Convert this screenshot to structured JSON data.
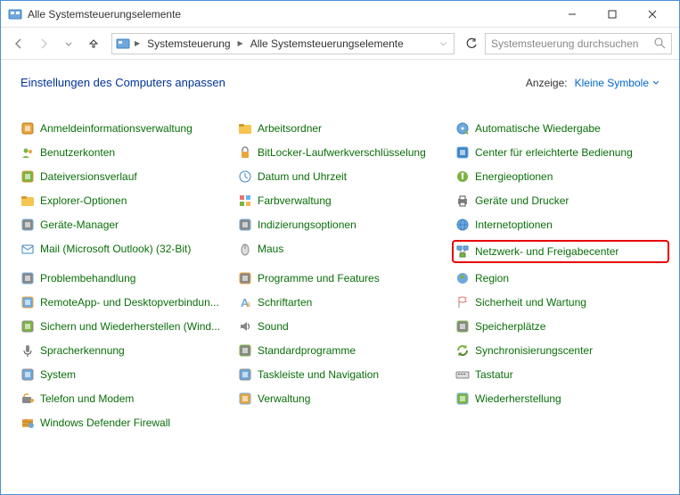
{
  "window": {
    "title": "Alle Systemsteuerungselemente"
  },
  "breadcrumb": {
    "root": "Systemsteuerung",
    "current": "Alle Systemsteuerungselemente"
  },
  "search": {
    "placeholder": "Systemsteuerung durchsuchen"
  },
  "header": {
    "title": "Einstellungen des Computers anpassen",
    "view_label": "Anzeige:",
    "view_value": "Kleine Symbole"
  },
  "highlight": "Netzwerk- und Freigabecenter",
  "items": [
    {
      "label": "Anmeldeinformationsverwaltung",
      "icon": "safe",
      "c1": "#e8a63e",
      "c2": "#b8791a"
    },
    {
      "label": "Arbeitsordner",
      "icon": "folder",
      "c1": "#f5c451",
      "c2": "#d19a2b"
    },
    {
      "label": "Automatische Wiedergabe",
      "icon": "disc",
      "c1": "#6fa8dc",
      "c2": "#3d85c6"
    },
    {
      "label": "Benutzerkonten",
      "icon": "users",
      "c1": "#7cb342",
      "c2": "#e8a63e"
    },
    {
      "label": "BitLocker-Laufwerkverschlüsselung",
      "icon": "lock",
      "c1": "#888",
      "c2": "#e8a63e"
    },
    {
      "label": "Center für erleichterte Bedienung",
      "icon": "access",
      "c1": "#3d85c6",
      "c2": "#6fa8dc"
    },
    {
      "label": "Dateiversionsverlauf",
      "icon": "history",
      "c1": "#7cb342",
      "c2": "#d19a2b"
    },
    {
      "label": "Datum und Uhrzeit",
      "icon": "clock",
      "c1": "#6fa8dc",
      "c2": "#3d85c6"
    },
    {
      "label": "Energieoptionen",
      "icon": "power",
      "c1": "#7cb342",
      "c2": "#558b2f"
    },
    {
      "label": "Explorer-Optionen",
      "icon": "folder",
      "c1": "#f5c451",
      "c2": "#d19a2b"
    },
    {
      "label": "Farbverwaltung",
      "icon": "color",
      "c1": "#e57373",
      "c2": "#64b5f6"
    },
    {
      "label": "Geräte und Drucker",
      "icon": "printer",
      "c1": "#888",
      "c2": "#555"
    },
    {
      "label": "Geräte-Manager",
      "icon": "device",
      "c1": "#888",
      "c2": "#6fa8dc"
    },
    {
      "label": "Indizierungsoptionen",
      "icon": "index",
      "c1": "#888",
      "c2": "#6fa8dc"
    },
    {
      "label": "Internetoptionen",
      "icon": "globe",
      "c1": "#6fa8dc",
      "c2": "#3d85c6"
    },
    {
      "label": "Mail (Microsoft Outlook) (32-Bit)",
      "icon": "mail",
      "c1": "#6fa8dc",
      "c2": "#3d85c6"
    },
    {
      "label": "Maus",
      "icon": "mouse",
      "c1": "#888",
      "c2": "#555"
    },
    {
      "label": "Netzwerk- und Freigabecenter",
      "icon": "network",
      "c1": "#6fa8dc",
      "c2": "#7cb342"
    },
    {
      "label": "Problembehandlung",
      "icon": "trouble",
      "c1": "#888",
      "c2": "#6fa8dc"
    },
    {
      "label": "Programme und Features",
      "icon": "programs",
      "c1": "#888",
      "c2": "#e8a63e"
    },
    {
      "label": "Region",
      "icon": "region",
      "c1": "#6fa8dc",
      "c2": "#7cb342"
    },
    {
      "label": "RemoteApp- und Desktopverbindun...",
      "icon": "remote",
      "c1": "#6fa8dc",
      "c2": "#e8a63e"
    },
    {
      "label": "Schriftarten",
      "icon": "fonts",
      "c1": "#6fa8dc",
      "c2": "#e8a63e"
    },
    {
      "label": "Sicherheit und Wartung",
      "icon": "flag",
      "c1": "#fff",
      "c2": "#e57373"
    },
    {
      "label": "Sichern und Wiederherstellen (Wind...",
      "icon": "backup",
      "c1": "#7cb342",
      "c2": "#888"
    },
    {
      "label": "Sound",
      "icon": "sound",
      "c1": "#888",
      "c2": "#555"
    },
    {
      "label": "Speicherplätze",
      "icon": "storage",
      "c1": "#888",
      "c2": "#7cb342"
    },
    {
      "label": "Spracherkennung",
      "icon": "mic",
      "c1": "#888",
      "c2": "#555"
    },
    {
      "label": "Standardprogramme",
      "icon": "default",
      "c1": "#888",
      "c2": "#7cb342"
    },
    {
      "label": "Synchronisierungscenter",
      "icon": "sync",
      "c1": "#7cb342",
      "c2": "#558b2f"
    },
    {
      "label": "System",
      "icon": "system",
      "c1": "#6fa8dc",
      "c2": "#888"
    },
    {
      "label": "Taskleiste und Navigation",
      "icon": "taskbar",
      "c1": "#6fa8dc",
      "c2": "#888"
    },
    {
      "label": "Tastatur",
      "icon": "keyboard",
      "c1": "#888",
      "c2": "#555"
    },
    {
      "label": "Telefon und Modem",
      "icon": "phone",
      "c1": "#888",
      "c2": "#e8a63e"
    },
    {
      "label": "Verwaltung",
      "icon": "admin",
      "c1": "#e8a63e",
      "c2": "#6fa8dc"
    },
    {
      "label": "Wiederherstellung",
      "icon": "recovery",
      "c1": "#7cb342",
      "c2": "#6fa8dc"
    },
    {
      "label": "Windows Defender Firewall",
      "icon": "firewall",
      "c1": "#e8a63e",
      "c2": "#6fa8dc"
    }
  ]
}
